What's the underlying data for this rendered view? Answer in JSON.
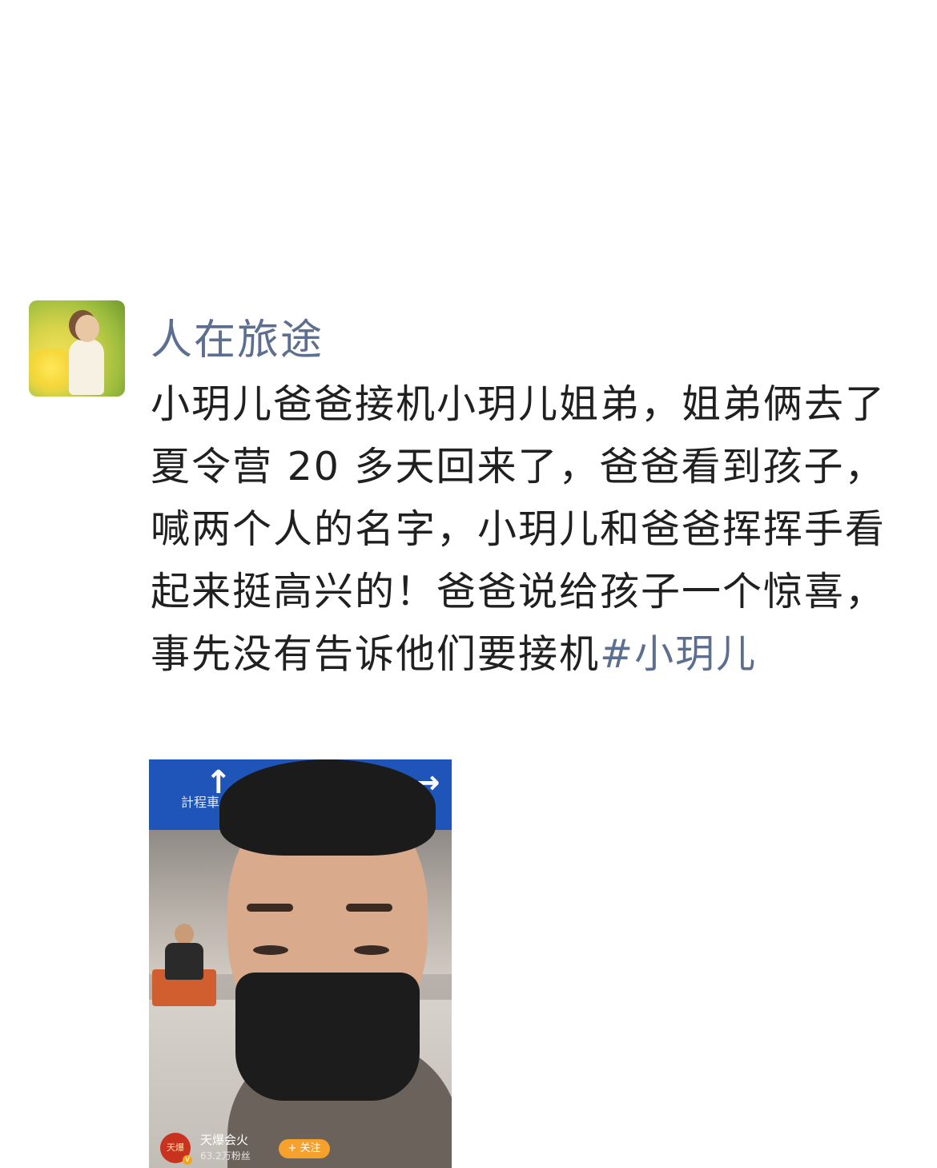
{
  "post": {
    "username": "人在旅途",
    "text": "小玥儿爸爸接机小玥儿姐弟，姐弟俩去了夏令营 20 多天回来了，爸爸看到孩子，喊两个人的名字，小玥儿和爸爸挥挥手看起来挺高兴的！爸爸说给孩子一个惊喜，事先没有告诉他们要接机",
    "hashtag": "#小玥儿"
  },
  "video": {
    "sign_text": "計程車 Taxi",
    "creator": {
      "avatar_text": "天爆",
      "verified_mark": "V",
      "name": "天爆会火",
      "fans": "63.2万粉丝",
      "follow_label": "+ 关注"
    }
  },
  "colors": {
    "link": "#5c6f91",
    "text": "#202020",
    "follow": "#f6a12b",
    "sign": "#1f55b8"
  }
}
